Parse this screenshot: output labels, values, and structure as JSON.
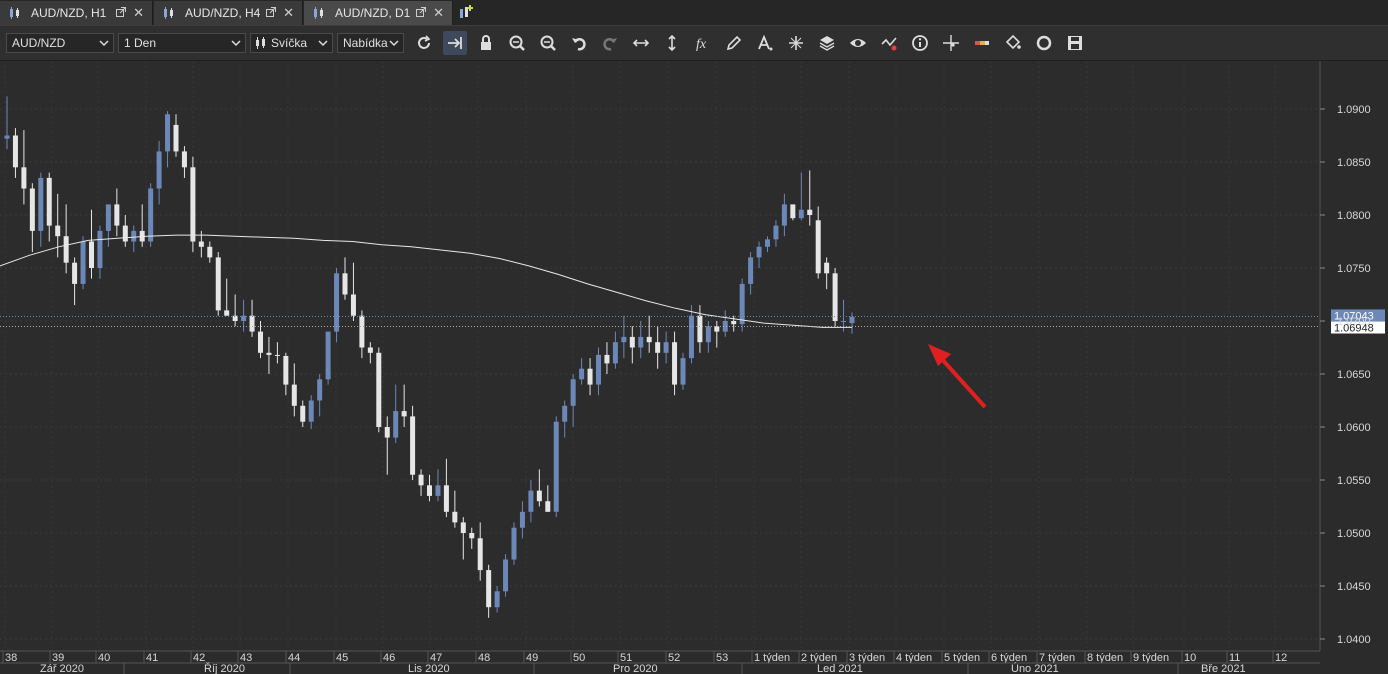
{
  "tabs": [
    {
      "label": "AUD/NZD, H1",
      "active": false
    },
    {
      "label": "AUD/NZD, H4",
      "active": false
    },
    {
      "label": "AUD/NZD, D1",
      "active": true
    }
  ],
  "toolbar": {
    "symbol": "AUD/NZD",
    "timeframe": "1 Den",
    "chart_type": "Svíčka",
    "menu": "Nabídka",
    "tools": [
      "refresh-icon",
      "auto-scroll-icon",
      "lock-icon",
      "zoom-in-icon",
      "zoom-out-icon",
      "undo-icon",
      "redo-icon",
      "horizontal-line-icon",
      "vertical-line-icon",
      "indicator-fx-icon",
      "pencil-icon",
      "text-tool-icon",
      "crosshair-tool-icon",
      "layers-icon",
      "eye-icon",
      "alert-icon",
      "info-icon",
      "cursor-cross-icon",
      "color-bar-icon",
      "paint-bucket-icon",
      "circle-icon",
      "save-icon"
    ]
  },
  "chart_data": {
    "type": "candlestick",
    "symbol": "AUD/NZD",
    "timeframe": "D1",
    "colors": {
      "bull": "#6b88b8",
      "bear": "#e6e6e6",
      "ma": "#e8e8e8",
      "background": "#2b2b2b",
      "arrow": "#e02020"
    },
    "ylim": [
      1.04,
      1.0925
    ],
    "y_ticks": [
      "1.0900",
      "1.0850",
      "1.0800",
      "1.0750",
      "1.0700",
      "1.0650",
      "1.0600",
      "1.0550",
      "1.0500",
      "1.0450",
      "1.0400"
    ],
    "price_labels": {
      "bid": "1.07043",
      "ask": "1.06948"
    },
    "x_week_labels": [
      "38",
      "39",
      "40",
      "41",
      "42",
      "43",
      "44",
      "45",
      "46",
      "47",
      "48",
      "49",
      "50",
      "51",
      "52",
      "53",
      "1 týden",
      "2 týden",
      "3 týden",
      "4 týden",
      "5 týden",
      "6 týden",
      "7 týden",
      "8 týden",
      "9 týden",
      "10",
      "11",
      "12"
    ],
    "x_month_labels": [
      "Zář 2020",
      "Říj 2020",
      "Lis 2020",
      "Pro 2020",
      "Led 2021",
      "Úno 2021",
      "Bře 2021"
    ],
    "candles": [
      [
        1.0872,
        1.0912,
        1.0862,
        1.0875
      ],
      [
        1.0875,
        1.0882,
        1.0835,
        1.0845
      ],
      [
        1.0845,
        1.088,
        1.081,
        1.0825
      ],
      [
        1.0825,
        1.083,
        1.0765,
        1.0785
      ],
      [
        1.0785,
        1.084,
        1.077,
        1.0835
      ],
      [
        1.0835,
        1.084,
        1.0775,
        1.079
      ],
      [
        1.079,
        1.082,
        1.076,
        1.078
      ],
      [
        1.078,
        1.081,
        1.0745,
        1.0755
      ],
      [
        1.0755,
        1.076,
        1.0715,
        1.0735
      ],
      [
        1.0735,
        1.078,
        1.073,
        1.0775
      ],
      [
        1.0775,
        1.0805,
        1.074,
        1.075
      ],
      [
        1.075,
        1.079,
        1.074,
        1.0785
      ],
      [
        1.0785,
        1.081,
        1.077,
        1.081
      ],
      [
        1.081,
        1.0825,
        1.078,
        1.079
      ],
      [
        1.079,
        1.08,
        1.077,
        1.0775
      ],
      [
        1.0775,
        1.079,
        1.0765,
        1.0785
      ],
      [
        1.0785,
        1.081,
        1.077,
        1.0775
      ],
      [
        1.0775,
        1.083,
        1.077,
        1.0825
      ],
      [
        1.0825,
        1.087,
        1.081,
        1.086
      ],
      [
        1.086,
        1.0898,
        1.0845,
        1.0895
      ],
      [
        1.0885,
        1.0895,
        1.0855,
        1.086
      ],
      [
        1.086,
        1.0865,
        1.0835,
        1.0845
      ],
      [
        1.0845,
        1.0855,
        1.0765,
        1.0775
      ],
      [
        1.0775,
        1.0785,
        1.076,
        1.077
      ],
      [
        1.077,
        1.0775,
        1.0755,
        1.076
      ],
      [
        1.076,
        1.0765,
        1.0705,
        1.071
      ],
      [
        1.071,
        1.074,
        1.0705,
        1.0705
      ],
      [
        1.0705,
        1.0725,
        1.0695,
        1.07
      ],
      [
        1.07,
        1.072,
        1.069,
        1.0705
      ],
      [
        1.0705,
        1.072,
        1.0685,
        1.069
      ],
      [
        1.069,
        1.07,
        1.0665,
        1.067
      ],
      [
        1.067,
        1.0685,
        1.065,
        1.0668
      ],
      [
        1.0668,
        1.068,
        1.066,
        1.0667
      ],
      [
        1.0667,
        1.067,
        1.063,
        1.064
      ],
      [
        1.064,
        1.066,
        1.061,
        1.062
      ],
      [
        1.062,
        1.0625,
        1.06,
        1.0605
      ],
      [
        1.0605,
        1.063,
        1.0598,
        1.0625
      ],
      [
        1.0625,
        1.065,
        1.061,
        1.0645
      ],
      [
        1.0645,
        1.069,
        1.064,
        1.069
      ],
      [
        1.069,
        1.075,
        1.068,
        1.0745
      ],
      [
        1.0745,
        1.076,
        1.072,
        1.0725
      ],
      [
        1.0725,
        1.0755,
        1.07,
        1.0705
      ],
      [
        1.0705,
        1.071,
        1.0665,
        1.0675
      ],
      [
        1.0675,
        1.068,
        1.066,
        1.067
      ],
      [
        1.067,
        1.0675,
        1.0595,
        1.06
      ],
      [
        1.06,
        1.061,
        1.0555,
        1.059
      ],
      [
        1.059,
        1.064,
        1.0585,
        1.0615
      ],
      [
        1.0615,
        1.064,
        1.06,
        1.061
      ],
      [
        1.061,
        1.062,
        1.055,
        1.0555
      ],
      [
        1.0555,
        1.056,
        1.0535,
        1.0545
      ],
      [
        1.0545,
        1.0555,
        1.053,
        1.0535
      ],
      [
        1.0535,
        1.056,
        1.053,
        1.0545
      ],
      [
        1.0545,
        1.057,
        1.0515,
        1.052
      ],
      [
        1.052,
        1.054,
        1.0505,
        1.051
      ],
      [
        1.051,
        1.0515,
        1.0475,
        1.05
      ],
      [
        1.05,
        1.0505,
        1.0485,
        1.0495
      ],
      [
        1.0495,
        1.051,
        1.0455,
        1.0465
      ],
      [
        1.0465,
        1.047,
        1.042,
        1.043
      ],
      [
        1.043,
        1.045,
        1.0425,
        1.0445
      ],
      [
        1.0445,
        1.048,
        1.044,
        1.0475
      ],
      [
        1.0475,
        1.051,
        1.047,
        1.0505
      ],
      [
        1.0505,
        1.053,
        1.0495,
        1.052
      ],
      [
        1.052,
        1.055,
        1.051,
        1.054
      ],
      [
        1.054,
        1.056,
        1.0525,
        1.053
      ],
      [
        1.053,
        1.0545,
        1.052,
        1.052
      ],
      [
        1.052,
        1.061,
        1.0515,
        1.0605
      ],
      [
        1.0605,
        1.0625,
        1.059,
        1.062
      ],
      [
        1.062,
        1.065,
        1.06,
        1.0645
      ],
      [
        1.0645,
        1.0665,
        1.064,
        1.0655
      ],
      [
        1.0655,
        1.0665,
        1.063,
        1.064
      ],
      [
        1.064,
        1.0675,
        1.063,
        1.0668
      ],
      [
        1.0668,
        1.068,
        1.065,
        1.066
      ],
      [
        1.066,
        1.069,
        1.0655,
        1.068
      ],
      [
        1.068,
        1.0705,
        1.0665,
        1.0685
      ],
      [
        1.0685,
        1.0695,
        1.066,
        1.0675
      ],
      [
        1.0675,
        1.07,
        1.0665,
        1.0685
      ],
      [
        1.0685,
        1.0705,
        1.067,
        1.068
      ],
      [
        1.068,
        1.0695,
        1.0655,
        1.067
      ],
      [
        1.067,
        1.069,
        1.066,
        1.068
      ],
      [
        1.068,
        1.069,
        1.063,
        1.064
      ],
      [
        1.064,
        1.067,
        1.0635,
        1.0665
      ],
      [
        1.0665,
        1.0715,
        1.066,
        1.0705
      ],
      [
        1.0705,
        1.0715,
        1.067,
        1.068
      ],
      [
        1.068,
        1.07,
        1.067,
        1.0695
      ],
      [
        1.0695,
        1.07,
        1.0675,
        1.069
      ],
      [
        1.069,
        1.071,
        1.0685,
        1.07
      ],
      [
        1.07,
        1.0705,
        1.069,
        1.0697
      ],
      [
        1.0697,
        1.074,
        1.069,
        1.0735
      ],
      [
        1.0735,
        1.0765,
        1.0725,
        1.076
      ],
      [
        1.076,
        1.0775,
        1.075,
        1.077
      ],
      [
        1.077,
        1.078,
        1.0765,
        1.0777
      ],
      [
        1.0777,
        1.0795,
        1.077,
        1.079
      ],
      [
        1.079,
        1.082,
        1.078,
        1.081
      ],
      [
        1.081,
        1.0805,
        1.0795,
        1.0797
      ],
      [
        1.0797,
        1.084,
        1.0795,
        1.0805
      ],
      [
        1.0805,
        1.0842,
        1.079,
        1.08
      ],
      [
        1.0795,
        1.0808,
        1.074,
        1.0745
      ],
      [
        1.0755,
        1.076,
        1.073,
        1.0745
      ],
      [
        1.0745,
        1.075,
        1.0695,
        1.07
      ],
      [
        1.07,
        1.072,
        1.069,
        1.07
      ],
      [
        1.0698,
        1.0708,
        1.0688,
        1.0704
      ]
    ],
    "ma": [
      1.0752,
      1.0762,
      1.077,
      1.0776,
      1.0778,
      1.078,
      1.0781,
      1.0781,
      1.078,
      1.0779,
      1.0778,
      1.0776,
      1.0775,
      1.0772,
      1.077,
      1.0767,
      1.0764,
      1.0759,
      1.0752,
      1.0744,
      1.0735,
      1.0727,
      1.0719,
      1.0712,
      1.0706,
      1.0702,
      1.0698,
      1.0696,
      1.0694,
      1.0694
    ]
  }
}
